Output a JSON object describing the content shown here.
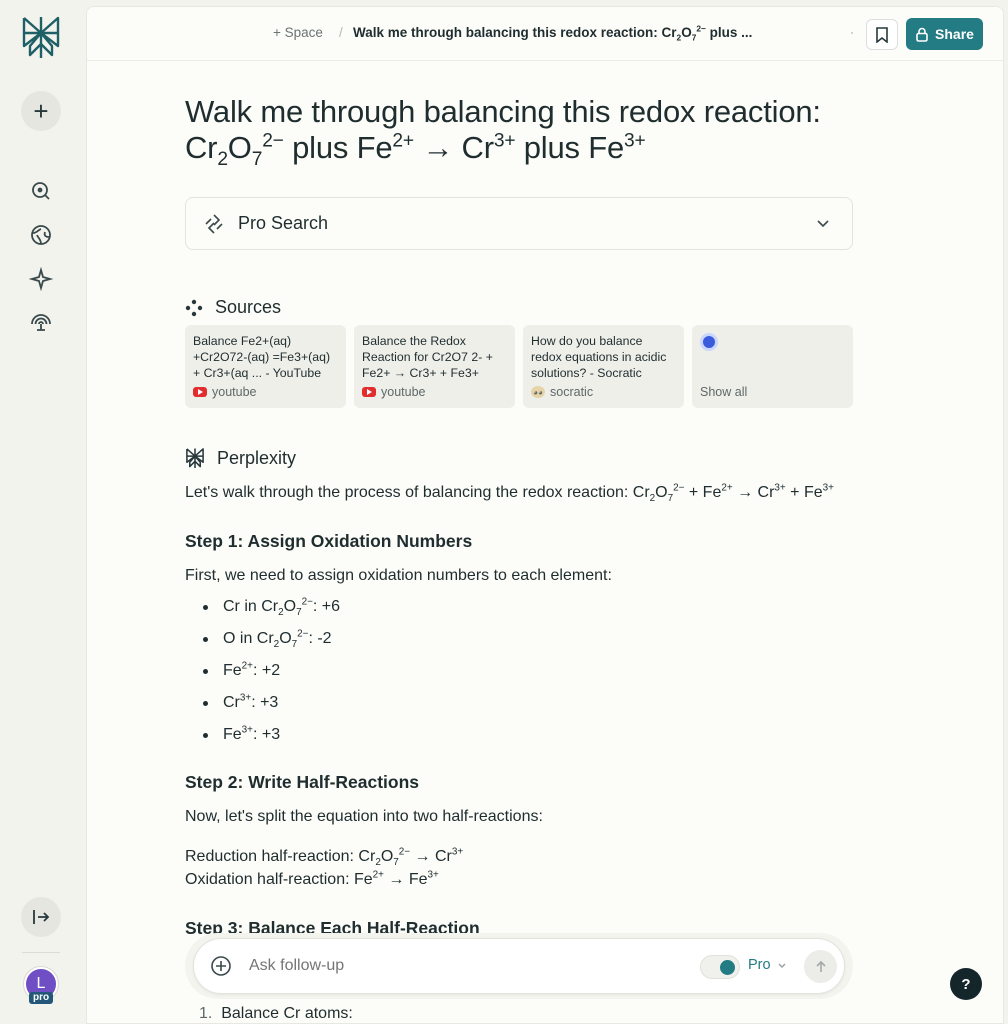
{
  "sidebar": {
    "new_label": "+",
    "avatar_initial": "L",
    "avatar_badge": "pro"
  },
  "header": {
    "space_label": "+ Space",
    "separator": "/",
    "thread_title_main": "Walk me through balancing this redox reaction: Cr",
    "thread_title_tail": " plus ...",
    "share_label": "Share"
  },
  "question": {
    "part1": "Walk me through balancing this redox reaction:",
    "part2": "plus Fe",
    "part3": "→ Cr",
    "part4": "plus Fe"
  },
  "pro_search": {
    "label": "Pro Search"
  },
  "sources": {
    "heading": "Sources",
    "items": [
      {
        "title": "Balance Fe2+(aq) +Cr2O72-(aq) =Fe3+(aq) + Cr3+(aq ... - YouTube",
        "site": "youtube"
      },
      {
        "title": "Balance the Redox Reaction for Cr2O7 2- + Fe2+ → Cr3+ + Fe3+",
        "site": "youtube"
      },
      {
        "title": "How do you balance redox equations in acidic solutions? - Socratic",
        "site": "socratic"
      }
    ],
    "show_all": "Show all"
  },
  "answer": {
    "heading": "Perplexity",
    "intro": "Let's walk through the process of balancing the redox reaction: Cr",
    "step1": "Step 1: Assign Oxidation Numbers",
    "step1_text": "First, we need to assign oxidation numbers to each element:",
    "bullets": [
      "Cr in Cr",
      "O in Cr",
      "Fe",
      "Cr",
      "Fe"
    ],
    "bullet_values": [
      ": +6",
      ": -2",
      ": +2",
      ": +3",
      ": +3"
    ],
    "step2": "Step 2: Write Half-Reactions",
    "step2_text": "Now, let's split the equation into two half-reactions:",
    "reduction_label": "Reduction half-reaction: Cr",
    "oxidation_label": "Oxidation half-reaction: Fe",
    "step3": "Step 3: Balance Each Half-Reaction",
    "numbered_1": "Balance Cr atoms:"
  },
  "followup": {
    "placeholder": "Ask follow-up",
    "mode": "Pro"
  },
  "help_label": "?",
  "colors": {
    "accent": "#237b83",
    "sidebar_bg": "#f3f3ee",
    "panel_bg": "#fcfcf9"
  }
}
